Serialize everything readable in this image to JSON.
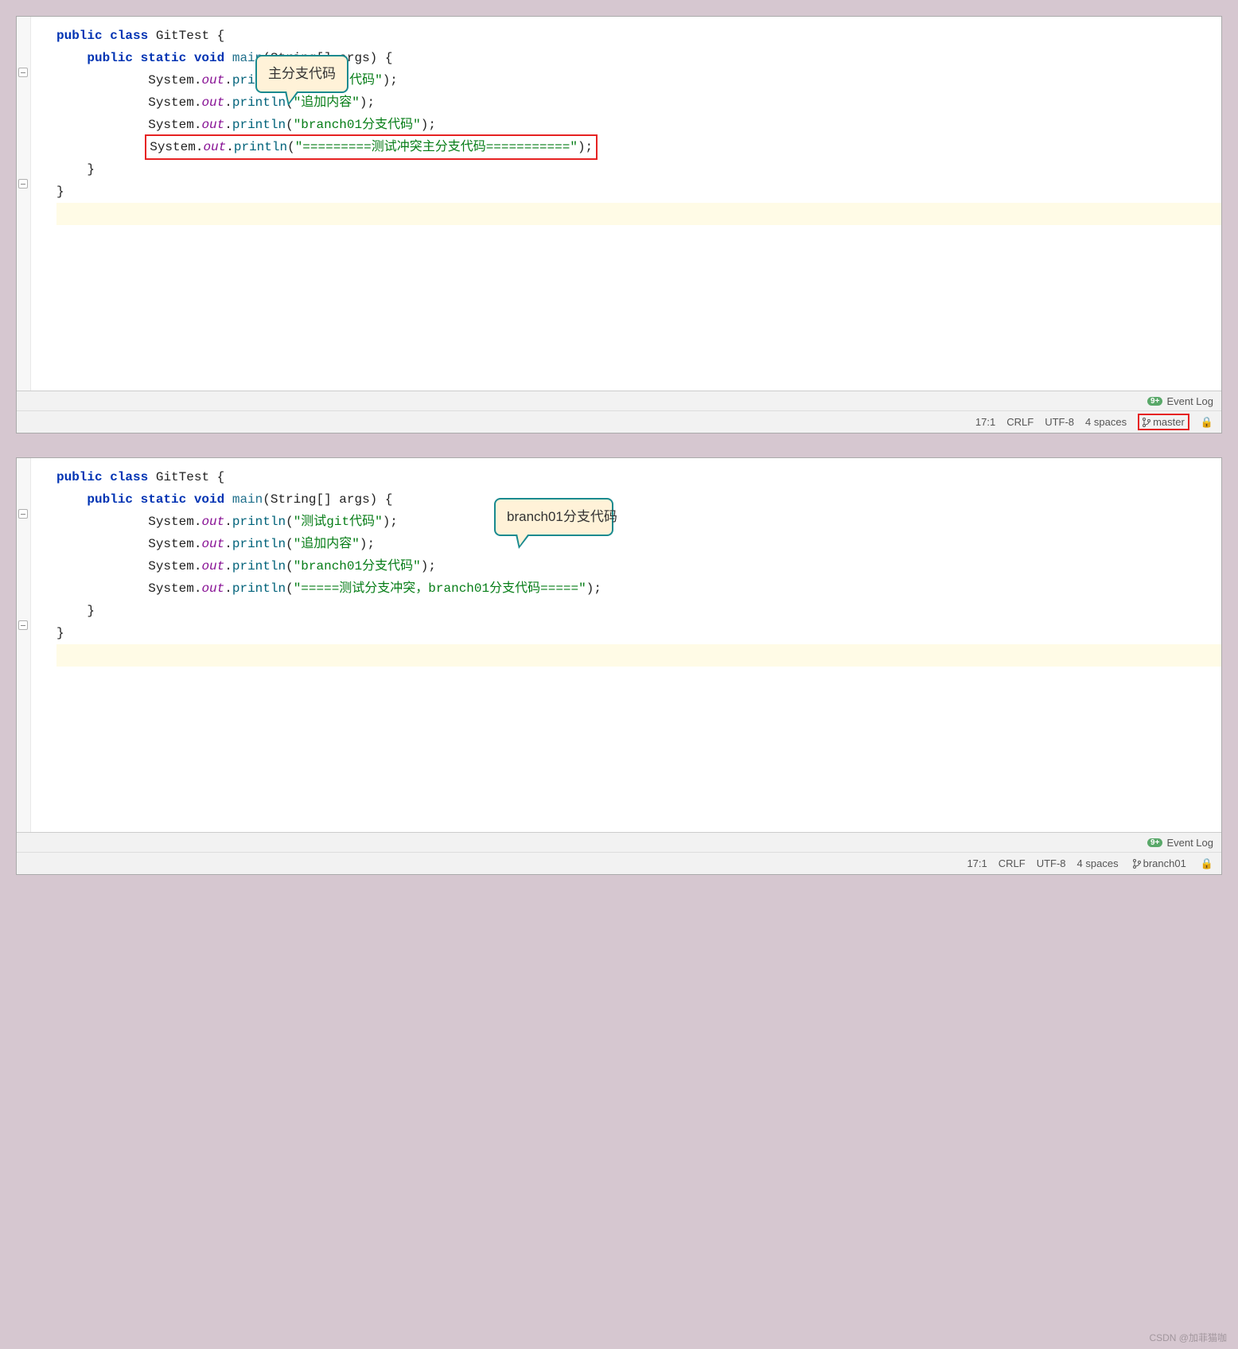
{
  "panes": [
    {
      "callout": "主分支代码",
      "callout_class": "callout1",
      "class_name": "GitTest",
      "method_sig": {
        "kw": "public static void",
        "name": "main",
        "args": "(String[] args) {"
      },
      "lines": [
        {
          "str": "\"测试git代码\""
        },
        {
          "str": "\"追加内容\""
        },
        {
          "str": "\"branch01分支代码\""
        },
        {
          "str": "\"=========测试冲突主分支代码===========\"",
          "boxed": true
        }
      ],
      "status": {
        "pos": "17:1",
        "eol": "CRLF",
        "enc": "UTF-8",
        "indent": "4 spaces",
        "branch": "master",
        "boxed": true
      }
    },
    {
      "callout": "branch01分支代码",
      "callout_class": "callout2",
      "class_name": "GitTest",
      "method_sig": {
        "kw": "public static void",
        "name": "main",
        "args": "(String[] args) {"
      },
      "lines": [
        {
          "str": "\"测试git代码\""
        },
        {
          "str": "\"追加内容\""
        },
        {
          "str": "\"branch01分支代码\""
        },
        {
          "str": "\"=====测试分支冲突，branch01分支代码=====\""
        }
      ],
      "status": {
        "pos": "17:1",
        "eol": "CRLF",
        "enc": "UTF-8",
        "indent": "4 spaces",
        "branch": "branch01",
        "boxed": false
      }
    }
  ],
  "event_log": "Event Log",
  "watermark": "CSDN @加菲猫咖"
}
